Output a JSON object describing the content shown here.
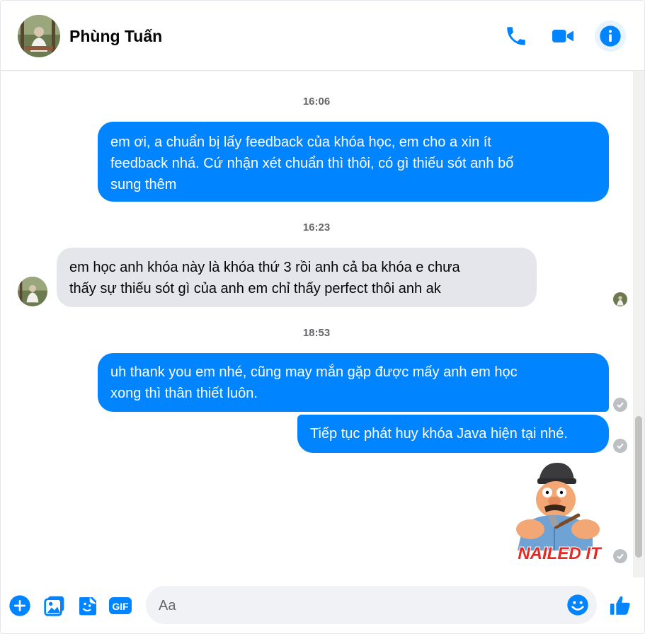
{
  "header": {
    "contact_name": "Phùng Tuấn",
    "buttons": [
      "phone-icon",
      "video-icon",
      "info-icon"
    ]
  },
  "thread": {
    "timestamps": [
      "16:06",
      "16:23",
      "18:53"
    ],
    "messages": [
      {
        "from": "me",
        "lines": [
          "em ơi, a chuẩn bị lấy feedback của khóa học, em cho a xin ít",
          "feedback nhá. Cứ nhận xét chuẩn thì thôi, có gì thiếu sót anh bổ",
          "sung thêm"
        ]
      },
      {
        "from": "contact",
        "lines": [
          "em học anh khóa này là khóa thứ 3 rồi anh cả ba khóa e chưa",
          "thấy sự thiếu sót gì của anh em chỉ thấy perfect thôi anh ak"
        ]
      },
      {
        "from": "me",
        "lines": [
          "uh thank you em nhé, cũng may mắn gặp được mấy anh em học",
          "xong thì thân thiết luôn."
        ]
      },
      {
        "from": "me",
        "lines": [
          "Tiếp tục phát huy khóa Java hiện tại nhé."
        ]
      }
    ],
    "sticker": {
      "caption": "NAILED IT"
    }
  },
  "composer": {
    "placeholder": "Aa",
    "icons": [
      "plus-icon",
      "photo-icon",
      "sticker-icon",
      "gif-icon",
      "emoji-icon",
      "like-icon"
    ],
    "gif_label": "GIF"
  },
  "colors": {
    "accent": "#0084ff",
    "incoming_bubble": "#e4e6eb",
    "timestamp": "#65676b"
  }
}
